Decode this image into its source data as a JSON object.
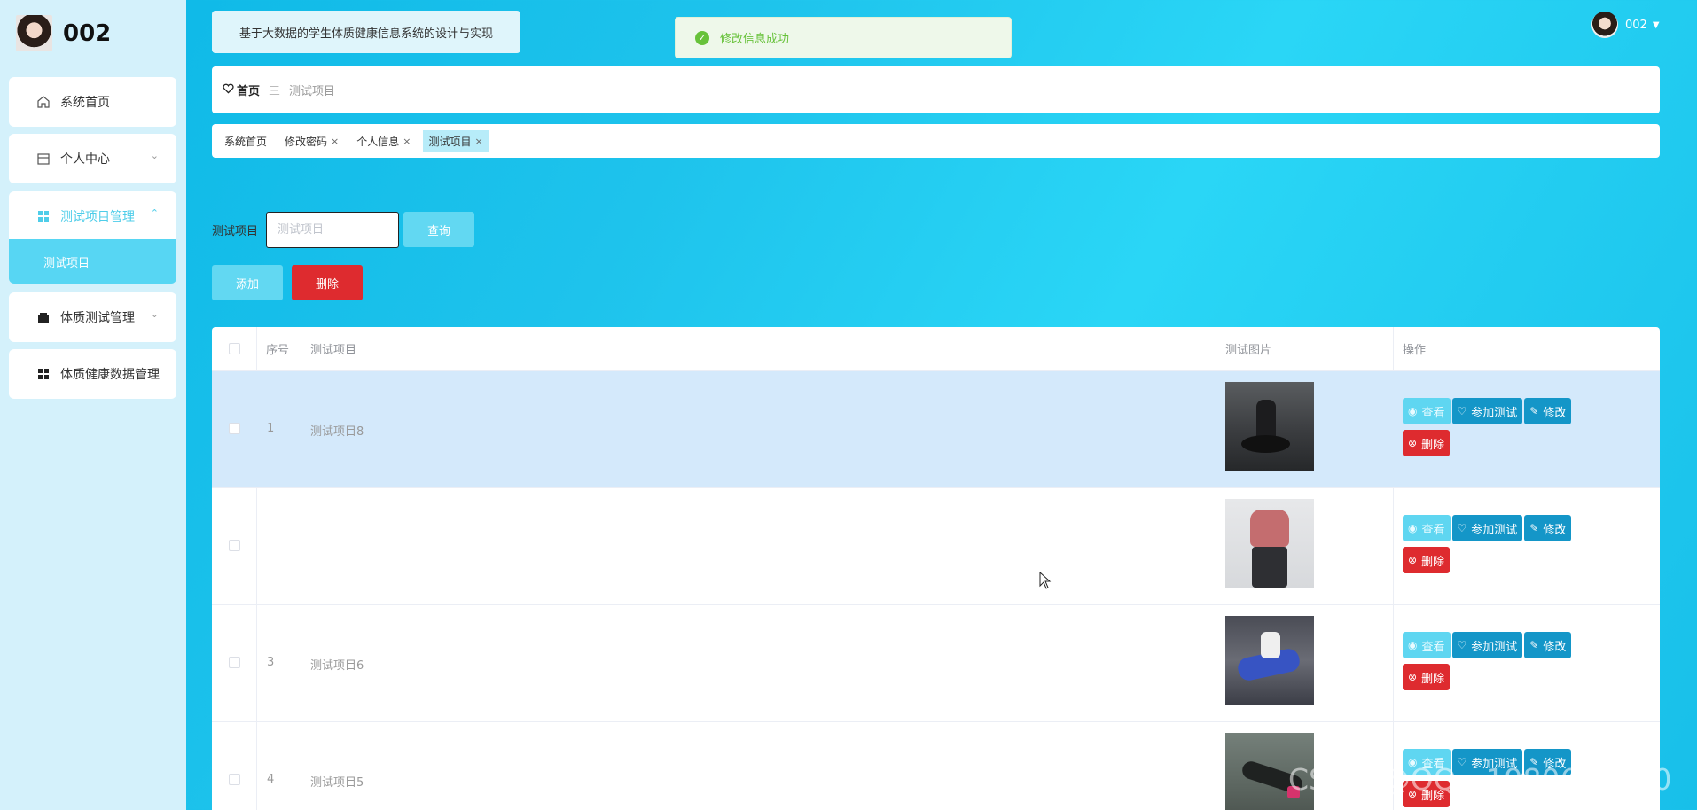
{
  "sidebar": {
    "brand_name": "002",
    "items": [
      {
        "label": "系统首页",
        "icon": "home-icon"
      },
      {
        "label": "个人中心",
        "icon": "calendar-icon"
      },
      {
        "label": "测试项目管理",
        "icon": "grid-icon"
      },
      {
        "label": "体质测试管理",
        "icon": "wallet-icon"
      },
      {
        "label": "体质健康数据管理",
        "icon": "grid-icon"
      }
    ],
    "submenu_item": "测试项目"
  },
  "header": {
    "app_title": "基于大数据的学生体质健康信息系统的设计与实现",
    "user_name": "002"
  },
  "toast": {
    "message": "修改信息成功",
    "type": "success"
  },
  "breadcrumb": {
    "home": "首页",
    "separator": "三",
    "current": "测试项目"
  },
  "tags": [
    {
      "label": "系统首页",
      "closable": false,
      "active": false
    },
    {
      "label": "修改密码",
      "closable": true,
      "active": false
    },
    {
      "label": "个人信息",
      "closable": true,
      "active": false
    },
    {
      "label": "测试项目",
      "closable": true,
      "active": true
    }
  ],
  "search": {
    "label": "测试项目",
    "placeholder": "测试项目",
    "query_button": "查询"
  },
  "actions": {
    "add_button": "添加",
    "delete_button": "删除"
  },
  "table": {
    "columns": [
      "序号",
      "测试项目",
      "测试图片",
      "操作"
    ],
    "rows": [
      {
        "no": "1",
        "name": "测试项目8",
        "highlighted": true
      },
      {
        "no": "",
        "name": "",
        "highlighted": false
      },
      {
        "no": "3",
        "name": "测试项目6",
        "highlighted": false
      },
      {
        "no": "4",
        "name": "测试项目5",
        "highlighted": false
      }
    ],
    "row_actions": {
      "view": "查看",
      "join": "参加测试",
      "edit": "修改",
      "delete": "删除"
    }
  },
  "watermark": "CSDN @QQ__1980691580",
  "colors": {
    "accent": "#1ec3ec",
    "sidebar_bg": "#d4f1fb",
    "danger": "#de2b2f",
    "primary_dark": "#1496c8",
    "success": "#67c23a"
  }
}
